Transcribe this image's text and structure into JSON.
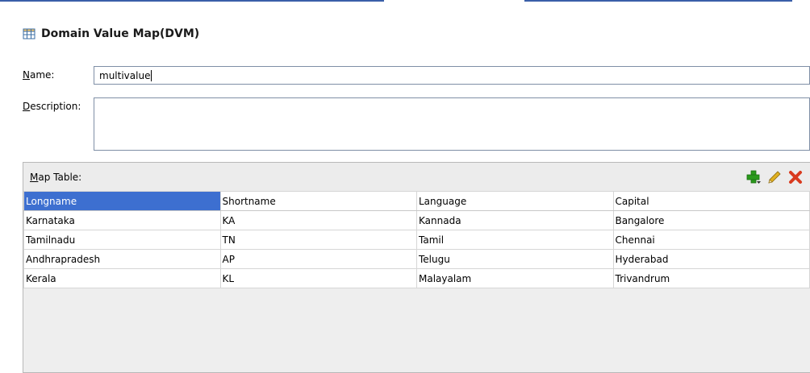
{
  "header": {
    "title": "Domain Value Map(DVM)",
    "icon": "table-icon"
  },
  "form": {
    "name_label_prefix": "N",
    "name_label_rest": "ame:",
    "name_value": "multivalue",
    "description_label_prefix": "D",
    "description_label_rest": "escription:",
    "description_value": ""
  },
  "map_table": {
    "label_prefix": "M",
    "label_rest": "ap Table:",
    "toolbar": {
      "add_icon": "add-icon",
      "edit_icon": "pencil-icon",
      "delete_icon": "delete-icon"
    },
    "columns": [
      "Longname",
      "Shortname",
      "Language",
      "Capital"
    ],
    "selected_column": "Longname",
    "rows": [
      [
        "Karnataka",
        "KA",
        "Kannada",
        "Bangalore"
      ],
      [
        "Tamilnadu",
        "TN",
        "Tamil",
        "Chennai"
      ],
      [
        "Andhrapradesh",
        "AP",
        "Telugu",
        "Hyderabad"
      ],
      [
        "Kerala",
        "KL",
        "Malayalam",
        "Trivandrum"
      ]
    ]
  },
  "colors": {
    "selected_header_bg": "#3d6fd0",
    "add_green": "#2a9a1c",
    "delete_red": "#d93a1e",
    "edit_yellow": "#e0b020"
  }
}
